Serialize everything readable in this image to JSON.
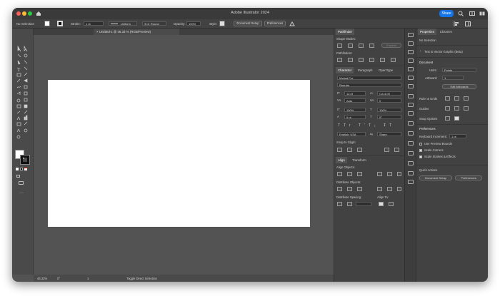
{
  "app": {
    "title": "Adobe Illustrator 2024",
    "share_label": "Share",
    "accent": "#1473e6"
  },
  "control_bar": {
    "selection": "No Selection",
    "stroke_label": "Stroke:",
    "stroke_weight": "1 pt",
    "profile": "Uniform",
    "brush": "3 pt. Round",
    "opacity_label": "Opacity:",
    "opacity_value": "100%",
    "style_label": "Style:",
    "doc_setup": "Document Setup",
    "preferences": "Preferences"
  },
  "document": {
    "tab_title": "Untitled-1 @ 46.33 % (RGB/Preview)"
  },
  "status_bar": {
    "zoom": "46.33%",
    "rotation": "0°",
    "artboard": "1",
    "tool": "Toggle Direct Selection"
  },
  "pathfinder": {
    "tab": "Pathfinder",
    "shape_modes": "Shape Modes:",
    "expand": "Expand",
    "pathfinders": "Pathfinders:"
  },
  "character": {
    "tabs": [
      "Character",
      "Paragraph",
      "OpenType"
    ],
    "font": "Myriad Pro",
    "style": "Regular",
    "size": "12 pt",
    "leading": "(14.4 pt)",
    "kerning": "Auto",
    "tracking": "0",
    "vscale": "100%",
    "hscale": "100%",
    "baseline": "0 pt",
    "rotation": "0°",
    "language": "English: USA",
    "aa": "Sharp",
    "snap": "Snap to Glyph"
  },
  "align": {
    "tabs": [
      "Align",
      "Transform"
    ],
    "align_objects": "Align Objects:",
    "distribute_objects": "Distribute Objects:",
    "distribute_spacing": "Distribute Spacing:",
    "align_to": "Align To:"
  },
  "properties": {
    "tabs": [
      "Properties",
      "Libraries"
    ],
    "selection": "No Selection",
    "text_to_vector": "Text to Vector Graphic (Beta)",
    "document_header": "Document",
    "units_label": "Units:",
    "units_value": "Points",
    "artboard_label": "Artboard:",
    "artboard_value": "1",
    "edit_artboards": "Edit Artboards",
    "rulers": "Ruler & Grids",
    "guides": "Guides",
    "snap_options": "Snap Options",
    "preferences_header": "Preferences",
    "keyboard_inc_label": "Keyboard Increment:",
    "keyboard_inc_value": "1 pt",
    "use_preview_bounds": "Use Preview Bounds",
    "scale_corners": "Scale Corners",
    "scale_strokes": "Scale Strokes & Effects",
    "quick_actions": "Quick Actions",
    "doc_setup_btn": "Document Setup",
    "prefs_btn": "Preferences"
  }
}
